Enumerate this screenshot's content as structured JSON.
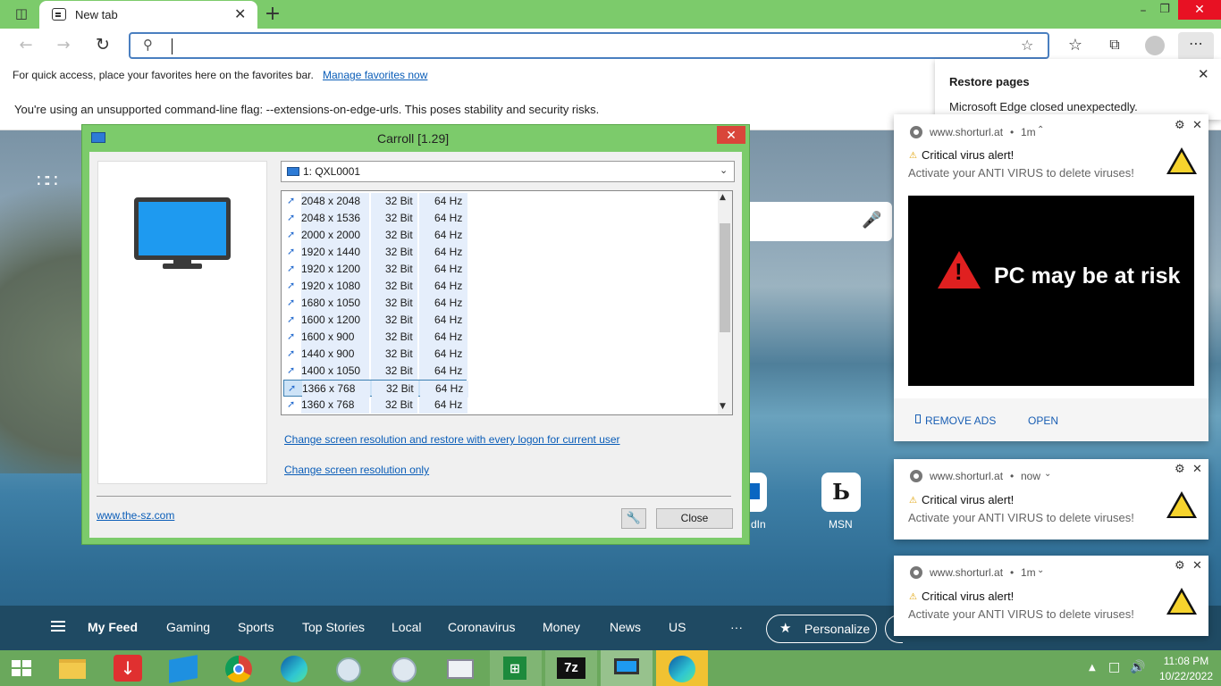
{
  "browser": {
    "tab_title": "New tab",
    "address_value": "",
    "favorites_hint": "For quick access, place your favorites here on the favorites bar.",
    "manage_favorites": "Manage favorites now",
    "warning": "You're using an unsupported command-line flag: --extensions-on-edge-urls. This poses stability and security risks."
  },
  "carroll": {
    "title": "Carroll [1.29]",
    "monitor_select": "1: QXL0001",
    "resolutions": [
      {
        "res": "2048 x 2048",
        "bits": "32 Bit",
        "hz": "64 Hz"
      },
      {
        "res": "2048 x 1536",
        "bits": "32 Bit",
        "hz": "64 Hz"
      },
      {
        "res": "2000 x 2000",
        "bits": "32 Bit",
        "hz": "64 Hz"
      },
      {
        "res": "1920 x 1440",
        "bits": "32 Bit",
        "hz": "64 Hz"
      },
      {
        "res": "1920 x 1200",
        "bits": "32 Bit",
        "hz": "64 Hz"
      },
      {
        "res": "1920 x 1080",
        "bits": "32 Bit",
        "hz": "64 Hz"
      },
      {
        "res": "1680 x 1050",
        "bits": "32 Bit",
        "hz": "64 Hz"
      },
      {
        "res": "1600 x 1200",
        "bits": "32 Bit",
        "hz": "64 Hz"
      },
      {
        "res": "1600 x 900",
        "bits": "32 Bit",
        "hz": "64 Hz"
      },
      {
        "res": "1440 x 900",
        "bits": "32 Bit",
        "hz": "64 Hz"
      },
      {
        "res": "1400 x 1050",
        "bits": "32 Bit",
        "hz": "64 Hz"
      },
      {
        "res": "1366 x 768",
        "bits": "32 Bit",
        "hz": "64 Hz"
      },
      {
        "res": "1360 x 768",
        "bits": "32 Bit",
        "hz": "64 Hz"
      }
    ],
    "selected_resolution": "1366 x 768",
    "link_restore": "Change screen resolution and restore with every logon for current user",
    "link_only": "Change screen resolution only",
    "website": "www.the-sz.com",
    "close_label": "Close"
  },
  "restore_panel": {
    "title": "Restore pages",
    "message": "Microsoft Edge closed unexpectedly."
  },
  "notifications": [
    {
      "site": "www.shorturl.at",
      "time": "1m",
      "title": "Critical virus alert!",
      "body": "Activate your ANTI VIRUS to delete viruses!",
      "image_text": "PC may be at risk",
      "action_remove": "REMOVE ADS",
      "action_open": "OPEN"
    },
    {
      "site": "www.shorturl.at",
      "time": "now",
      "title": "Critical virus alert!",
      "body": "Activate your ANTI VIRUS to delete viruses!"
    },
    {
      "site": "www.shorturl.at",
      "time": "1m",
      "title": "Critical virus alert!",
      "body": "Activate your ANTI VIRUS to delete viruses!"
    }
  ],
  "newtab": {
    "quick_links": [
      "dIn",
      "MSN"
    ],
    "feed_tabs": [
      "My Feed",
      "Gaming",
      "Sports",
      "Top Stories",
      "Local",
      "Coronavirus",
      "Money",
      "News",
      "US"
    ],
    "more": "···",
    "personalize": "Personalize"
  },
  "taskbar": {
    "time": "11:08 PM",
    "date": "10/22/2022",
    "pinned": [
      "file-explorer",
      "download-app",
      "windows-app",
      "chrome",
      "edge",
      "disc-app",
      "disc-app-2",
      "image-app",
      "excel-app",
      "7zip",
      "carroll-app",
      "edge-active"
    ]
  },
  "colors": {
    "accent_green": "#7ccb6b",
    "link_blue": "#0a5db8",
    "alert_red": "#e02020"
  }
}
